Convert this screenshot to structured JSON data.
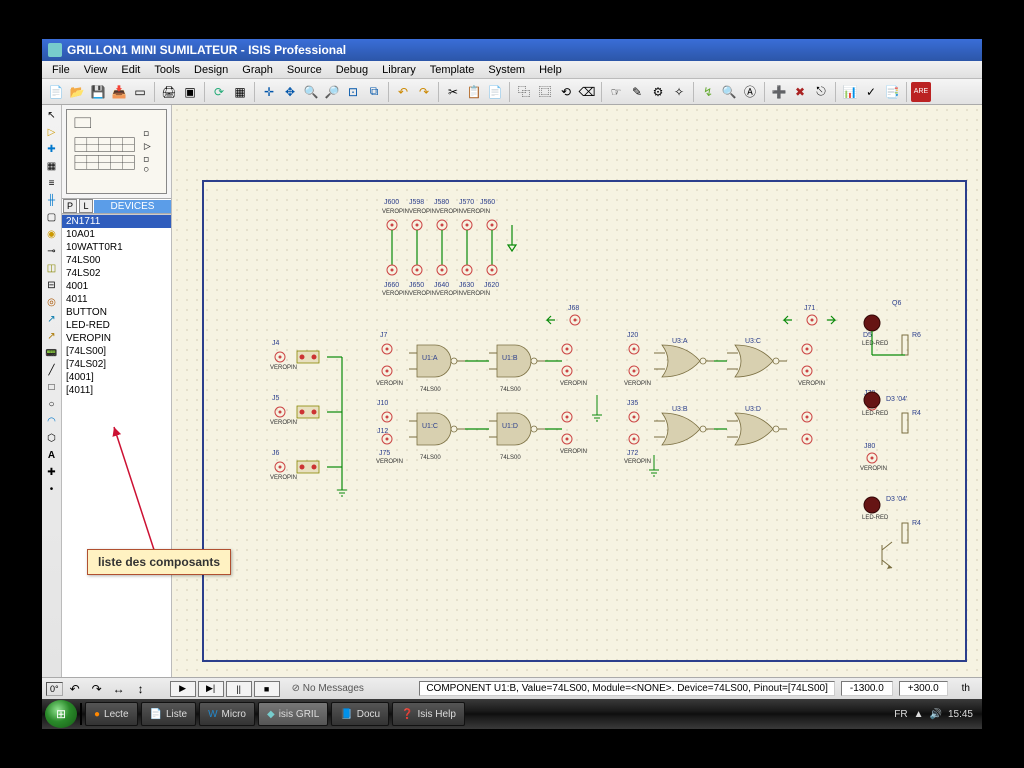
{
  "window": {
    "title": "GRILLON1 MINI SUMILATEUR - ISIS Professional"
  },
  "menu": {
    "items": [
      "File",
      "View",
      "Edit",
      "Tools",
      "Design",
      "Graph",
      "Source",
      "Debug",
      "Library",
      "Template",
      "System",
      "Help"
    ]
  },
  "sidebar": {
    "pl_p": "P",
    "pl_l": "L",
    "devices_header": "DEVICES",
    "items": [
      {
        "label": "2N1711",
        "sel": true
      },
      {
        "label": "10A01"
      },
      {
        "label": "10WATT0R1"
      },
      {
        "label": "74LS00"
      },
      {
        "label": "74LS02"
      },
      {
        "label": "4001"
      },
      {
        "label": "4011"
      },
      {
        "label": "BUTTON"
      },
      {
        "label": "LED-RED"
      },
      {
        "label": "VEROPIN"
      },
      {
        "label": "[74LS00]"
      },
      {
        "label": "[74LS02]"
      },
      {
        "label": "[4001]"
      },
      {
        "label": "[4011]"
      }
    ]
  },
  "callout": {
    "text": "liste des composants"
  },
  "status": {
    "nomsg": "No Messages",
    "info": "COMPONENT U1:B, Value=74LS00, Module=<NONE>. Device=74LS00, Pinout=[74LS00]",
    "coord_x": "-1300.0",
    "coord_y": "+300.0",
    "coord_unit": "th"
  },
  "taskbar": {
    "items": [
      "Lecte",
      "Liste",
      "Micro",
      "isis GRIL",
      "Docu",
      "Isis Help"
    ],
    "lang": "FR",
    "clock": "15:45"
  },
  "schematic": {
    "top_jumpers": [
      "J600",
      "J598",
      "J580",
      "J570",
      "J560"
    ],
    "bot_jumpers": [
      "J660",
      "J650",
      "J640",
      "J630",
      "J620"
    ],
    "vero_label": "VEROPIN",
    "left_j": [
      "J4",
      "J5",
      "J6"
    ],
    "gates_row1": [
      "U1:A",
      "U1:B"
    ],
    "gates_row2": [
      "U1:C",
      "U1:D"
    ],
    "gates_col3r1": [
      "U3:A",
      "U3:C"
    ],
    "gates_col3r2": [
      "U3:B",
      "U3:D"
    ],
    "gate_value": "74LS00",
    "j7": "J7",
    "j10": "J10",
    "j12": "J12",
    "j75": "J75",
    "j20": "J20",
    "j35": "J35",
    "j72": "J72",
    "j68": "J68",
    "j71": "J71",
    "j78": "J78",
    "j80": "J80",
    "q6": "Q6",
    "r6": "R6",
    "r4": "R4",
    "d5": "D5",
    "d3": "D3  '04'",
    "d3b": "D3  '04'"
  }
}
